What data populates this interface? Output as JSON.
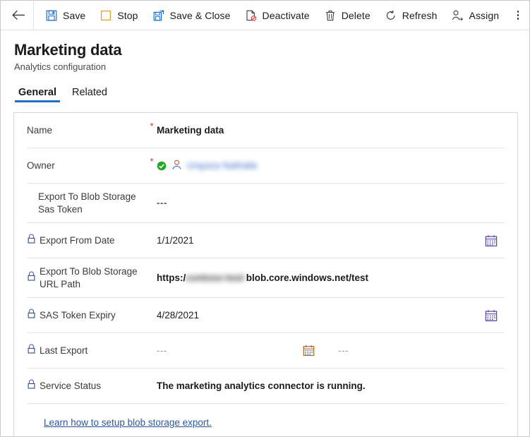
{
  "commandbar": {
    "back": "back-arrow",
    "items": [
      {
        "label": "Save",
        "icon": "save-icon"
      },
      {
        "label": "Stop",
        "icon": "stop-icon"
      },
      {
        "label": "Save & Close",
        "icon": "save-and-close-icon"
      },
      {
        "label": "Deactivate",
        "icon": "deactivate-icon"
      },
      {
        "label": "Delete",
        "icon": "delete-icon"
      },
      {
        "label": "Refresh",
        "icon": "refresh-icon"
      },
      {
        "label": "Assign",
        "icon": "assign-icon"
      }
    ],
    "overflow": "more-commands"
  },
  "header": {
    "title": "Marketing data",
    "subtitle": "Analytics configuration"
  },
  "tabs": [
    {
      "label": "General",
      "active": true
    },
    {
      "label": "Related",
      "active": false
    }
  ],
  "form": {
    "rows": [
      {
        "label": "Name",
        "required": "*",
        "value": "Marketing data",
        "locked": false
      },
      {
        "label": "Owner",
        "required": "*",
        "value": "Urquiza Nathalie",
        "redacted": true,
        "locked": false
      },
      {
        "label": "Export To Blob Storage Sas Token",
        "value": "---",
        "locked": false
      },
      {
        "label": "Export From Date",
        "value": "1/1/2021",
        "locked": true,
        "calendar": "calendar-icon"
      },
      {
        "label": "Export To Blob Storage URL Path",
        "value_prefix": "https:/",
        "value_redacted": "contoso-test-",
        "value_suffix": "blob.core.windows.net/test",
        "locked": true
      },
      {
        "label": "SAS Token Expiry",
        "value": "4/28/2021",
        "locked": true,
        "calendar": "calendar-icon"
      },
      {
        "label": "Last Export",
        "value": "---",
        "value2": "---",
        "locked": true,
        "calendar": "calendar-icon"
      },
      {
        "label": "Service Status",
        "value": "The marketing analytics connector is running.",
        "locked": true
      }
    ],
    "link": "Learn how to setup blob storage export."
  },
  "colors": {
    "accent": "#1f6fd0",
    "link": "#2b579a",
    "required": "#c0392b",
    "success": "#22a722",
    "save_icon": "#1f6fd0",
    "stop_icon": "#e8a33d",
    "deactivate_icon": "#e03e3e",
    "lock_icon": "#6b4fbb"
  }
}
